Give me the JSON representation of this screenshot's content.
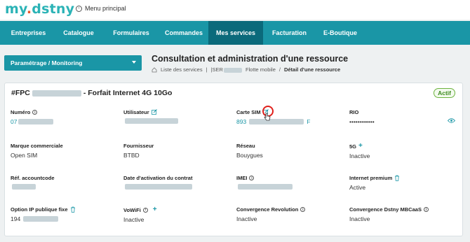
{
  "header": {
    "logo_text": "my",
    "logo_dot": ".",
    "logo_text2": "dstny",
    "menu_principal": "Menu principal"
  },
  "nav": {
    "items": [
      "Entreprises",
      "Catalogue",
      "Formulaires",
      "Commandes",
      "Mes services",
      "Facturation",
      "E-Boutique"
    ],
    "active": "Mes services"
  },
  "sidebar": {
    "dropdown_label": "Paramétrage / Monitoring"
  },
  "page": {
    "title": "Consultation et administration d'une ressource",
    "breadcrumb": [
      "Liste des services",
      "|SER",
      "Flotte mobile",
      "Détail d'une ressource"
    ]
  },
  "resource": {
    "title_prefix": "#FPC",
    "title_suffix": "- Forfait Internet 4G 10Go",
    "status": "Actif",
    "fields": {
      "numero": {
        "label": "Numéro",
        "value": "07"
      },
      "utilisateur": {
        "label": "Utilisateur",
        "value": ""
      },
      "carte_sim": {
        "label": "Carte SIM",
        "value_prefix": "893",
        "value_suffix": "F"
      },
      "rio": {
        "label": "RIO",
        "value": "••••••••••••"
      },
      "marque_commerciale": {
        "label": "Marque commerciale",
        "value": "Open SIM"
      },
      "fournisseur": {
        "label": "Fournisseur",
        "value": "BTBD"
      },
      "reseau": {
        "label": "Réseau",
        "value": "Bouygues"
      },
      "five_g": {
        "label": "5G",
        "value": "Inactive"
      },
      "ref_accountcode": {
        "label": "Réf. accountcode",
        "value": ""
      },
      "date_activation": {
        "label": "Date d'activation du contrat",
        "value": ""
      },
      "imei": {
        "label": "IMEI",
        "value": ""
      },
      "internet_premium": {
        "label": "Internet premium",
        "value": "Active"
      },
      "option_ip": {
        "label": "Option IP publique fixe",
        "value": "194"
      },
      "vowifi": {
        "label": "VoWiFi",
        "value": "Inactive"
      },
      "convergence_revolution": {
        "label": "Convergence Revolution",
        "value": "Inactive"
      },
      "convergence_mbcaas": {
        "label": "Convergence Dstny MBCaaS",
        "value": "Inactive"
      }
    }
  },
  "colors": {
    "brand": "#1a96a6",
    "brand_dark": "#0b6a7b",
    "logo": "#2bb3b6",
    "logo_dot": "#e9572a",
    "status_green": "#6cb33e",
    "highlight_red": "#e0201b"
  }
}
